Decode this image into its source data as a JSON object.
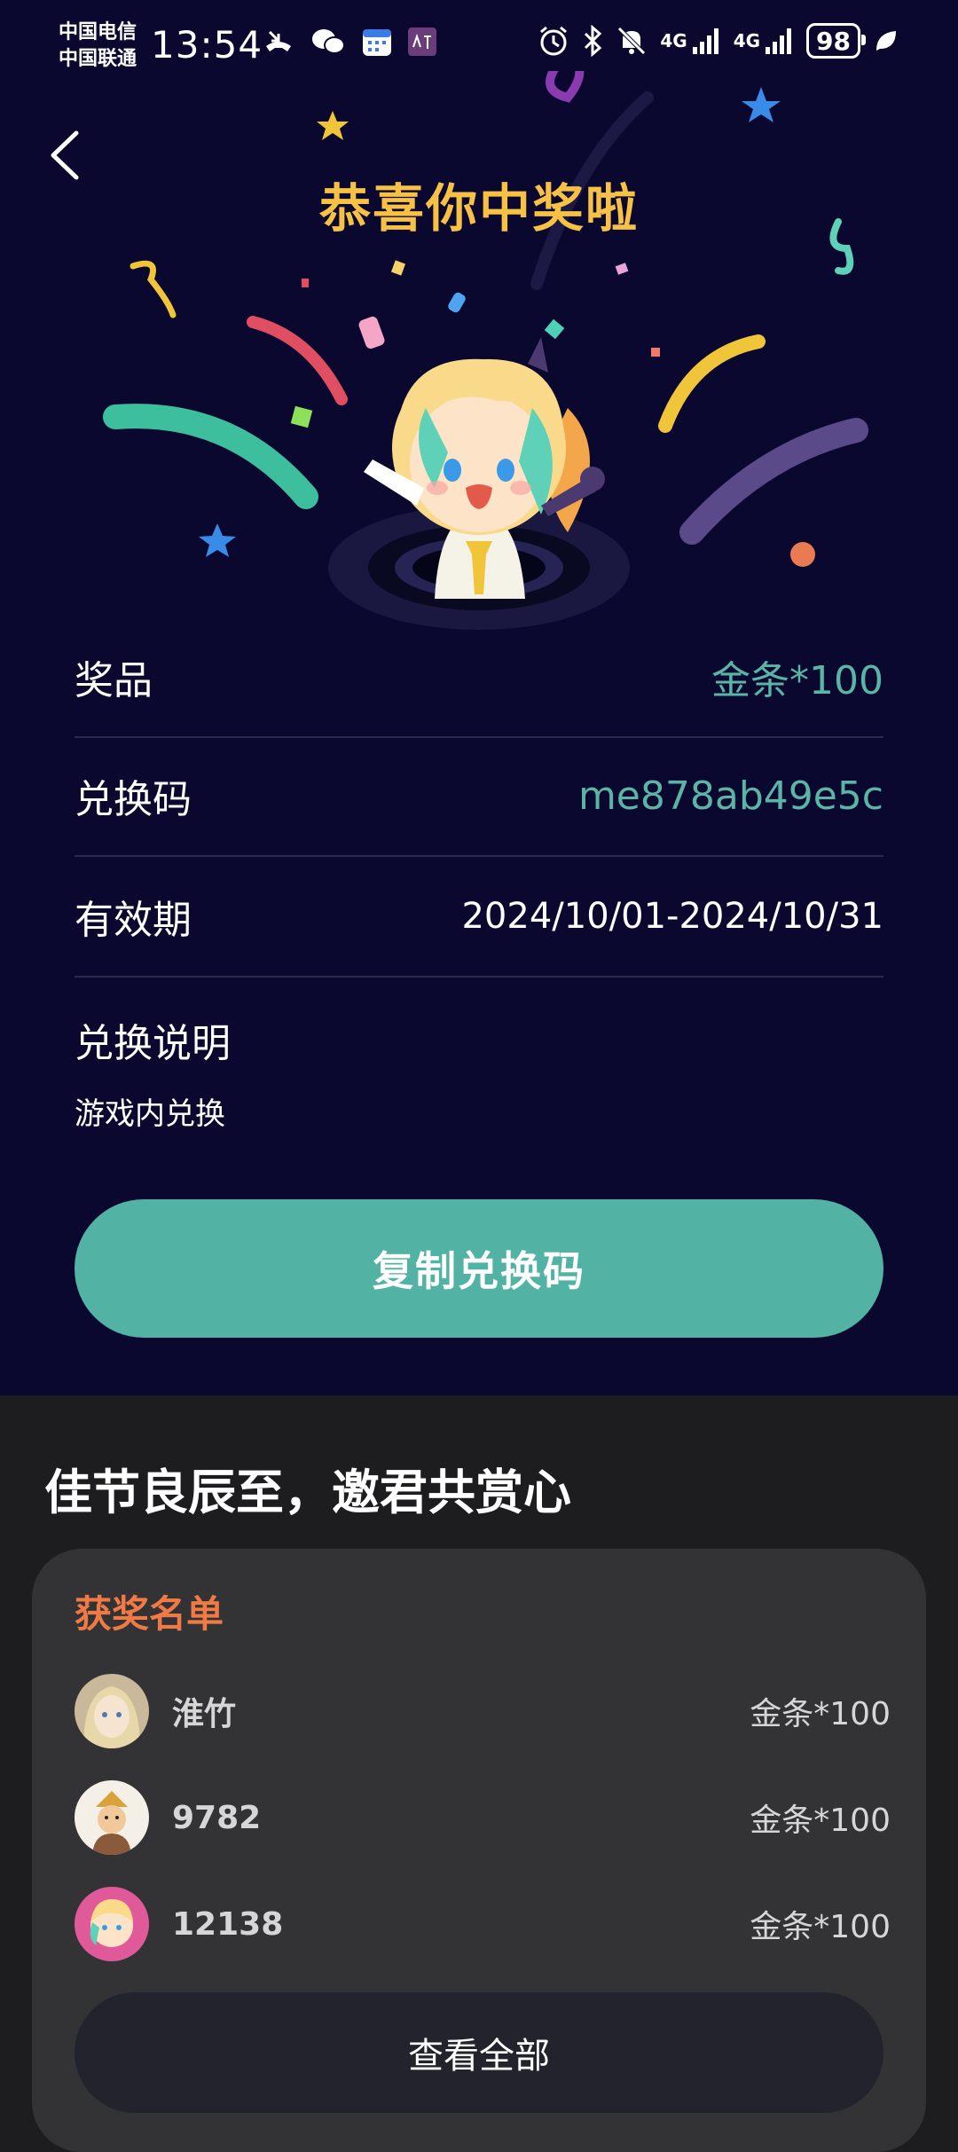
{
  "status_bar": {
    "carrier1": "中国电信",
    "carrier2": "中国联通",
    "time": "13:54",
    "net1": "4G",
    "net2": "4G",
    "battery": "98"
  },
  "header": {
    "title": "恭喜你中奖啦"
  },
  "prize_details": {
    "prize_label": "奖品",
    "prize_value": "金条*100",
    "code_label": "兑换码",
    "code_value": "me878ab49e5c",
    "validity_label": "有效期",
    "validity_value": "2024/10/01-2024/10/31",
    "desc_label": "兑换说明",
    "desc_text": "游戏内兑换"
  },
  "copy_button": "复制兑换码",
  "section_title": "佳节良辰至，邀君共赏心",
  "winners": {
    "title": "获奖名单",
    "items": [
      {
        "name": "淮竹",
        "prize": "金条*100"
      },
      {
        "name": "9782",
        "prize": "金条*100"
      },
      {
        "name": "12138",
        "prize": "金条*100"
      }
    ],
    "view_all": "查看全部"
  },
  "colors": {
    "background_top": "#0b0830",
    "title_gold": "#f6c145",
    "teal": "#52b3a4",
    "winner_title": "#ef7a45"
  }
}
